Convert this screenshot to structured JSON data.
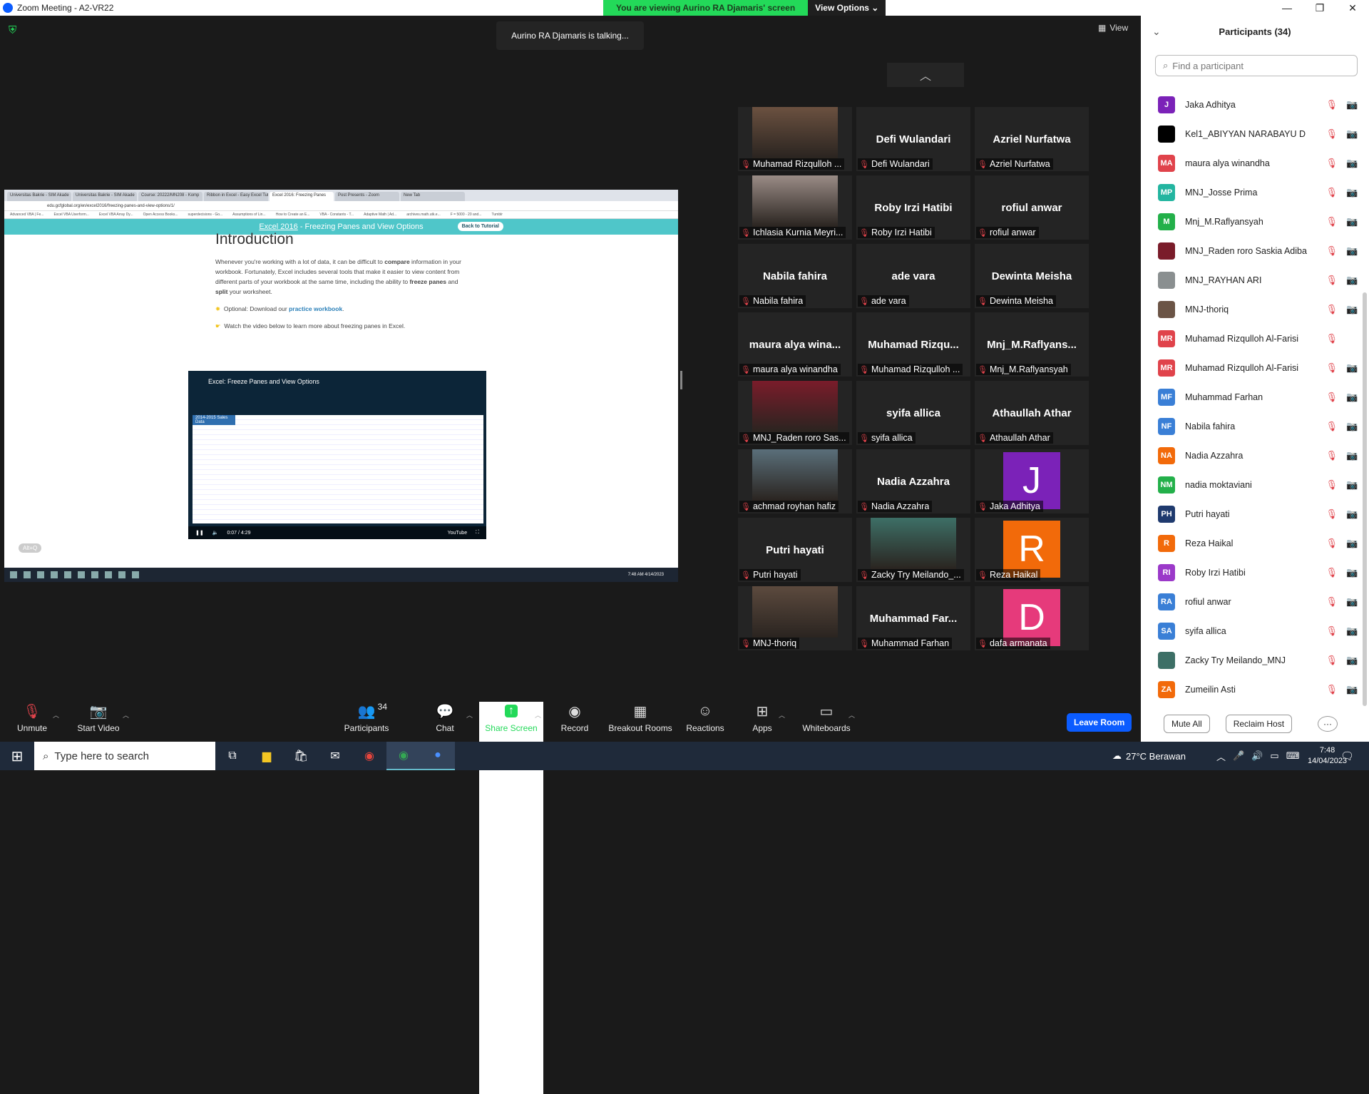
{
  "window": {
    "title": "Zoom Meeting - A2-VR22",
    "minimize": "—",
    "maximize": "❐",
    "close": "✕"
  },
  "banner": {
    "message": "You are viewing Aurino RA Djamaris' screen",
    "view_options": "View Options"
  },
  "talking": "Aurino RA Djamaris is talking...",
  "view_button": "View",
  "shared_screen": {
    "tabs": [
      "Universitas Bakrie - SIM Akade",
      "Universitas Bakrie - SIM Akade",
      "Course: 20222/MN208 - Komp",
      "Ribbon in Excel - Easy Excel Tut",
      "Excel 2016: Freezing Panes",
      "Post Presents - Zoom",
      "New Tab"
    ],
    "url": "edu.gcfglobal.org/en/excel2016/freezing-panes-and-view-options/1/",
    "bookmarks": [
      "Advanced VBA | Fe...",
      "Excel VBA Userform...",
      "Excel VBA Array Dy...",
      "Open Access Books...",
      "superdecisions - Go...",
      "Assumptions of Lin...",
      "How to Create an E...",
      "VBA - Constants - T...",
      "Adaptive Math | Ad...",
      "archives.math.utk.e...",
      "F = 5000 - 20 and...",
      "Tumblr"
    ],
    "header_link": "Excel 2016",
    "header_text": " - Freezing Panes and View Options",
    "back_button": "Back to Tutorial",
    "heading": "Introduction",
    "para1_a": "Whenever you're working with a lot of data, it can be difficult to ",
    "para1_b": "compare",
    "para1_c": " information in your workbook. Fortunately, Excel includes several tools that make it easier to view content from different parts of your workbook at the same time, including the ability to ",
    "para1_d": "freeze panes",
    "para1_e": " and ",
    "para1_f": "split",
    "para1_g": " your worksheet.",
    "optional_a": "Optional: Download our ",
    "optional_link": "practice workbook",
    "optional_b": ".",
    "watch": "Watch the video below to learn more about freezing panes in Excel.",
    "video_title": "Excel: Freeze Panes and View Options",
    "sheet_title": "2014-2015 Sales Data",
    "video_time": "0:07 / 4:29",
    "youtube": "YouTube",
    "alt_q": "Alt+Q",
    "clock": "7:48 AM 4/14/2023"
  },
  "tiles": [
    {
      "name": "",
      "label": "Muhamad Rizqulloh ...",
      "type": "photo",
      "color": "#6b5140"
    },
    {
      "name": "Defi Wulandari",
      "label": "Defi Wulandari",
      "type": "name"
    },
    {
      "name": "Azriel Nurfatwa",
      "label": "Azriel Nurfatwa",
      "type": "name"
    },
    {
      "name": "",
      "label": "Ichlasia Kurnia Meyri...",
      "type": "photo",
      "color": "#9a8c86"
    },
    {
      "name": "Roby Irzi Hatibi",
      "label": "Roby Irzi Hatibi",
      "type": "name"
    },
    {
      "name": "rofiul anwar",
      "label": "rofiul anwar",
      "type": "name"
    },
    {
      "name": "Nabila fahira",
      "label": "Nabila fahira",
      "type": "name"
    },
    {
      "name": "ade vara",
      "label": "ade vara",
      "type": "name"
    },
    {
      "name": "Dewinta Meisha",
      "label": "Dewinta Meisha",
      "type": "name"
    },
    {
      "name": "maura alya wina...",
      "label": "maura alya winandha",
      "type": "name"
    },
    {
      "name": "Muhamad Rizqu...",
      "label": "Muhamad Rizqulloh ...",
      "type": "name"
    },
    {
      "name": "Mnj_M.Raflyans...",
      "label": "Mnj_M.Raflyansyah",
      "type": "name"
    },
    {
      "name": "",
      "label": "MNJ_Raden roro Sas...",
      "type": "photo",
      "color": "#7a1c2a"
    },
    {
      "name": "syifa allica",
      "label": "syifa allica",
      "type": "name"
    },
    {
      "name": "Athaullah Athar",
      "label": "Athaullah Athar",
      "type": "name"
    },
    {
      "name": "",
      "label": "achmad royhan hafiz",
      "type": "photo",
      "color": "#5a6f7a"
    },
    {
      "name": "Nadia Azzahra",
      "label": "Nadia Azzahra",
      "type": "name"
    },
    {
      "name": "J",
      "label": "Jaka Adhitya",
      "type": "letter",
      "color": "#7b22b8"
    },
    {
      "name": "Putri hayati",
      "label": "Putri hayati",
      "type": "name"
    },
    {
      "name": "",
      "label": "Zacky Try Meilando_...",
      "type": "photo",
      "color": "#3d6f66"
    },
    {
      "name": "R",
      "label": "Reza Haikal",
      "type": "letter",
      "color": "#f26a0a"
    },
    {
      "name": "",
      "label": "MNJ-thoriq",
      "type": "photo",
      "color": "#5c4a3e"
    },
    {
      "name": "Muhammad Far...",
      "label": "Muhammad Farhan",
      "type": "name"
    },
    {
      "name": "D",
      "label": "dafa armanata",
      "type": "letter",
      "color": "#e63a7b"
    }
  ],
  "participants_panel": {
    "title": "Participants (34)",
    "search_placeholder": "Find a participant",
    "items": [
      {
        "initials": "J",
        "name": "Jaka Adhitya",
        "color": "#7b22b8",
        "cam": "off"
      },
      {
        "initials": "",
        "name": "Kel1_ABIYYAN NARABAYU D",
        "color": "#000000",
        "cam": "on"
      },
      {
        "initials": "MA",
        "name": "maura alya winandha",
        "color": "#e0434b",
        "cam": "off"
      },
      {
        "initials": "MP",
        "name": "MNJ_Josse Prima",
        "color": "#23b5a0",
        "cam": "on"
      },
      {
        "initials": "M",
        "name": "Mnj_M.Raflyansyah",
        "color": "#23b04a",
        "cam": "off"
      },
      {
        "initials": "",
        "name": "MNJ_Raden roro Saskia Adiba",
        "color": "#7a1c2a",
        "cam": "off"
      },
      {
        "initials": "",
        "name": "MNJ_RAYHAN ARI",
        "color": "#8a8f90",
        "cam": "on"
      },
      {
        "initials": "",
        "name": "MNJ-thoriq",
        "color": "#6b5446",
        "cam": "off"
      },
      {
        "initials": "MR",
        "name": "Muhamad Rizqulloh Al-Farisi",
        "color": "#e0434b",
        "cam": "none"
      },
      {
        "initials": "MR",
        "name": "Muhamad Rizqulloh Al-Farisi",
        "color": "#e0434b",
        "cam": "on"
      },
      {
        "initials": "MF",
        "name": "Muhammad Farhan",
        "color": "#3a7fd6",
        "cam": "off"
      },
      {
        "initials": "NF",
        "name": "Nabila fahira",
        "color": "#3a7fd6",
        "cam": "off"
      },
      {
        "initials": "NA",
        "name": "Nadia Azzahra",
        "color": "#f26a0a",
        "cam": "off"
      },
      {
        "initials": "NM",
        "name": "nadia moktaviani",
        "color": "#23b04a",
        "cam": "on"
      },
      {
        "initials": "PH",
        "name": "Putri hayati",
        "color": "#1f3a6e",
        "cam": "off"
      },
      {
        "initials": "R",
        "name": "Reza Haikal",
        "color": "#f26a0a",
        "cam": "off"
      },
      {
        "initials": "RI",
        "name": "Roby Irzi Hatibi",
        "color": "#9b39c9",
        "cam": "off"
      },
      {
        "initials": "RA",
        "name": "rofiul anwar",
        "color": "#3a7fd6",
        "cam": "off"
      },
      {
        "initials": "SA",
        "name": "syifa allica",
        "color": "#3a7fd6",
        "cam": "off"
      },
      {
        "initials": "",
        "name": "Zacky Try Meilando_MNJ",
        "color": "#3d6f66",
        "cam": "off"
      },
      {
        "initials": "ZA",
        "name": "Zumeilin Asti",
        "color": "#f26a0a",
        "cam": "on"
      }
    ],
    "mute_all": "Mute All",
    "reclaim_host": "Reclaim Host",
    "more": "···"
  },
  "toolbar": {
    "unmute": "Unmute",
    "start_video": "Start Video",
    "participants": "Participants",
    "participants_count": "34",
    "chat": "Chat",
    "share_screen": "Share Screen",
    "record": "Record",
    "breakout_rooms": "Breakout Rooms",
    "reactions": "Reactions",
    "apps": "Apps",
    "whiteboards": "Whiteboards",
    "leave_room": "Leave Room"
  },
  "taskbar": {
    "search_placeholder": "Type here to search",
    "weather": "27°C  Berawan",
    "time": "7:48",
    "date": "14/04/2023"
  }
}
